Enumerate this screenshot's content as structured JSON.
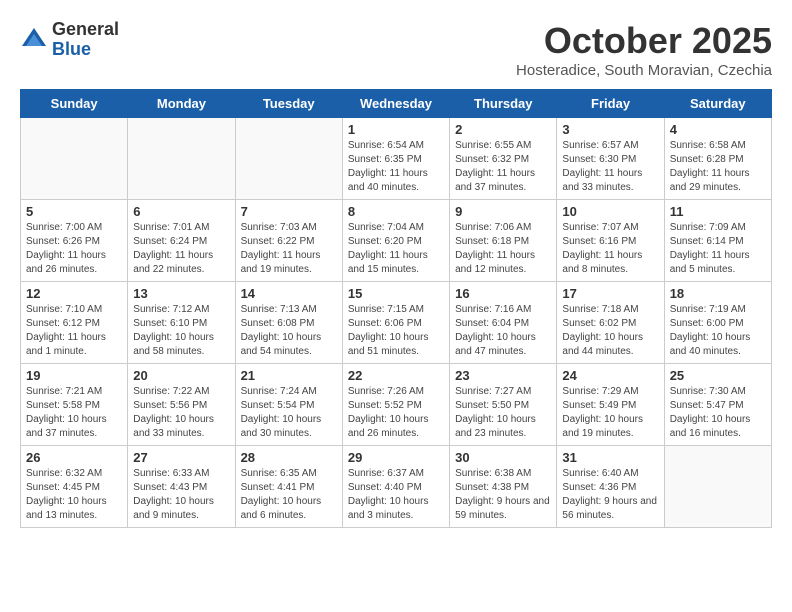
{
  "logo": {
    "general": "General",
    "blue": "Blue"
  },
  "title": "October 2025",
  "location": "Hosteradice, South Moravian, Czechia",
  "days_of_week": [
    "Sunday",
    "Monday",
    "Tuesday",
    "Wednesday",
    "Thursday",
    "Friday",
    "Saturday"
  ],
  "weeks": [
    [
      {
        "day": "",
        "info": ""
      },
      {
        "day": "",
        "info": ""
      },
      {
        "day": "",
        "info": ""
      },
      {
        "day": "1",
        "info": "Sunrise: 6:54 AM\nSunset: 6:35 PM\nDaylight: 11 hours\nand 40 minutes."
      },
      {
        "day": "2",
        "info": "Sunrise: 6:55 AM\nSunset: 6:32 PM\nDaylight: 11 hours\nand 37 minutes."
      },
      {
        "day": "3",
        "info": "Sunrise: 6:57 AM\nSunset: 6:30 PM\nDaylight: 11 hours\nand 33 minutes."
      },
      {
        "day": "4",
        "info": "Sunrise: 6:58 AM\nSunset: 6:28 PM\nDaylight: 11 hours\nand 29 minutes."
      }
    ],
    [
      {
        "day": "5",
        "info": "Sunrise: 7:00 AM\nSunset: 6:26 PM\nDaylight: 11 hours\nand 26 minutes."
      },
      {
        "day": "6",
        "info": "Sunrise: 7:01 AM\nSunset: 6:24 PM\nDaylight: 11 hours\nand 22 minutes."
      },
      {
        "day": "7",
        "info": "Sunrise: 7:03 AM\nSunset: 6:22 PM\nDaylight: 11 hours\nand 19 minutes."
      },
      {
        "day": "8",
        "info": "Sunrise: 7:04 AM\nSunset: 6:20 PM\nDaylight: 11 hours\nand 15 minutes."
      },
      {
        "day": "9",
        "info": "Sunrise: 7:06 AM\nSunset: 6:18 PM\nDaylight: 11 hours\nand 12 minutes."
      },
      {
        "day": "10",
        "info": "Sunrise: 7:07 AM\nSunset: 6:16 PM\nDaylight: 11 hours\nand 8 minutes."
      },
      {
        "day": "11",
        "info": "Sunrise: 7:09 AM\nSunset: 6:14 PM\nDaylight: 11 hours\nand 5 minutes."
      }
    ],
    [
      {
        "day": "12",
        "info": "Sunrise: 7:10 AM\nSunset: 6:12 PM\nDaylight: 11 hours\nand 1 minute."
      },
      {
        "day": "13",
        "info": "Sunrise: 7:12 AM\nSunset: 6:10 PM\nDaylight: 10 hours\nand 58 minutes."
      },
      {
        "day": "14",
        "info": "Sunrise: 7:13 AM\nSunset: 6:08 PM\nDaylight: 10 hours\nand 54 minutes."
      },
      {
        "day": "15",
        "info": "Sunrise: 7:15 AM\nSunset: 6:06 PM\nDaylight: 10 hours\nand 51 minutes."
      },
      {
        "day": "16",
        "info": "Sunrise: 7:16 AM\nSunset: 6:04 PM\nDaylight: 10 hours\nand 47 minutes."
      },
      {
        "day": "17",
        "info": "Sunrise: 7:18 AM\nSunset: 6:02 PM\nDaylight: 10 hours\nand 44 minutes."
      },
      {
        "day": "18",
        "info": "Sunrise: 7:19 AM\nSunset: 6:00 PM\nDaylight: 10 hours\nand 40 minutes."
      }
    ],
    [
      {
        "day": "19",
        "info": "Sunrise: 7:21 AM\nSunset: 5:58 PM\nDaylight: 10 hours\nand 37 minutes."
      },
      {
        "day": "20",
        "info": "Sunrise: 7:22 AM\nSunset: 5:56 PM\nDaylight: 10 hours\nand 33 minutes."
      },
      {
        "day": "21",
        "info": "Sunrise: 7:24 AM\nSunset: 5:54 PM\nDaylight: 10 hours\nand 30 minutes."
      },
      {
        "day": "22",
        "info": "Sunrise: 7:26 AM\nSunset: 5:52 PM\nDaylight: 10 hours\nand 26 minutes."
      },
      {
        "day": "23",
        "info": "Sunrise: 7:27 AM\nSunset: 5:50 PM\nDaylight: 10 hours\nand 23 minutes."
      },
      {
        "day": "24",
        "info": "Sunrise: 7:29 AM\nSunset: 5:49 PM\nDaylight: 10 hours\nand 19 minutes."
      },
      {
        "day": "25",
        "info": "Sunrise: 7:30 AM\nSunset: 5:47 PM\nDaylight: 10 hours\nand 16 minutes."
      }
    ],
    [
      {
        "day": "26",
        "info": "Sunrise: 6:32 AM\nSunset: 4:45 PM\nDaylight: 10 hours\nand 13 minutes."
      },
      {
        "day": "27",
        "info": "Sunrise: 6:33 AM\nSunset: 4:43 PM\nDaylight: 10 hours\nand 9 minutes."
      },
      {
        "day": "28",
        "info": "Sunrise: 6:35 AM\nSunset: 4:41 PM\nDaylight: 10 hours\nand 6 minutes."
      },
      {
        "day": "29",
        "info": "Sunrise: 6:37 AM\nSunset: 4:40 PM\nDaylight: 10 hours\nand 3 minutes."
      },
      {
        "day": "30",
        "info": "Sunrise: 6:38 AM\nSunset: 4:38 PM\nDaylight: 9 hours\nand 59 minutes."
      },
      {
        "day": "31",
        "info": "Sunrise: 6:40 AM\nSunset: 4:36 PM\nDaylight: 9 hours\nand 56 minutes."
      },
      {
        "day": "",
        "info": ""
      }
    ]
  ]
}
